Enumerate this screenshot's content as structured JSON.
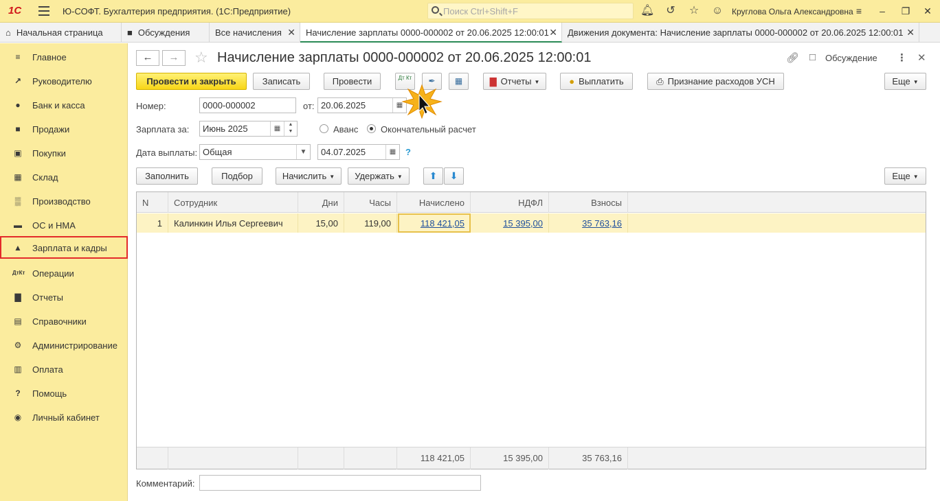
{
  "titlebar": {
    "logo": "1С",
    "title": "Ю-СОФТ. Бухгалтерия предприятия.  (1С:Предприятие)",
    "search_placeholder": "Поиск Ctrl+Shift+F",
    "user": "Круглова Ольга Александровна"
  },
  "tabs": [
    {
      "label": "Начальная страница"
    },
    {
      "label": "Обсуждения"
    },
    {
      "label": "Все начисления"
    },
    {
      "label": "Начисление зарплаты 0000-000002 от 20.06.2025 12:00:01"
    },
    {
      "label": "Движения документа: Начисление зарплаты 0000-000002 от 20.06.2025 12:00:01"
    }
  ],
  "sidebar": {
    "items": [
      {
        "label": "Главное",
        "icon": "menu-icon"
      },
      {
        "label": "Руководителю",
        "icon": "trend-icon"
      },
      {
        "label": "Банк и касса",
        "icon": "coin-icon"
      },
      {
        "label": "Продажи",
        "icon": "bag-icon"
      },
      {
        "label": "Покупки",
        "icon": "cart-icon"
      },
      {
        "label": "Склад",
        "icon": "warehouse-icon"
      },
      {
        "label": "Производство",
        "icon": "factory-icon"
      },
      {
        "label": "ОС и НМА",
        "icon": "truck-icon"
      },
      {
        "label": "Зарплата и кадры",
        "icon": "person-icon"
      },
      {
        "label": "Операции",
        "icon": "dt-kt-icon"
      },
      {
        "label": "Отчеты",
        "icon": "bar-chart-icon"
      },
      {
        "label": "Справочники",
        "icon": "book-icon"
      },
      {
        "label": "Администрирование",
        "icon": "gear-icon"
      },
      {
        "label": "Оплата",
        "icon": "card-icon"
      },
      {
        "label": "Помощь",
        "icon": "question-icon"
      },
      {
        "label": "Личный кабинет",
        "icon": "account-icon"
      }
    ],
    "selected": "Зарплата и кадры"
  },
  "document": {
    "title": "Начисление зарплаты 0000-000002 от 20.06.2025 12:00:01",
    "discussion_label": "Обсуждение"
  },
  "toolbar": {
    "post_close": "Провести и закрыть",
    "save": "Записать",
    "post": "Провести",
    "dtkt": "Дт Кт",
    "reports": "Отчеты",
    "pay": "Выплатить",
    "usn": "Признание расходов УСН",
    "more": "Еще"
  },
  "form": {
    "number_label": "Номер:",
    "number_value": "0000-000002",
    "date_label": "от:",
    "date_value": "20.06.2025",
    "period_label": "Зарплата за:",
    "period_value": "Июнь 2025",
    "advance_label": "Аванс",
    "final_label": "Окончательный расчет",
    "pay_date_label": "Дата выплаты:",
    "pay_type_value": "Общая",
    "pay_date_value": "04.07.2025",
    "help": "?",
    "comment_label": "Комментарий:",
    "comment_value": ""
  },
  "table_toolbar": {
    "fill": "Заполнить",
    "select": "Подбор",
    "accrue": "Начислить",
    "withhold": "Удержать",
    "more": "Еще"
  },
  "table": {
    "columns": [
      "N",
      "Сотрудник",
      "Дни",
      "Часы",
      "Начислено",
      "НДФЛ",
      "Взносы"
    ],
    "rows": [
      {
        "n": "1",
        "employee": "Калинкин Илья Сергеевич",
        "days": "15,00",
        "hours": "119,00",
        "accrued": "118 421,05",
        "ndfl": "15 395,00",
        "contributions": "35 763,16"
      }
    ],
    "totals": {
      "accrued": "118 421,05",
      "ndfl": "15 395,00",
      "contributions": "35 763,16"
    }
  },
  "colors": {
    "panel_yellow": "#fbec9e",
    "primary_button": "#f8d617",
    "selection_outline": "#e32a2a",
    "link": "#1e4f9c",
    "selected_row": "#fdf3c4"
  }
}
